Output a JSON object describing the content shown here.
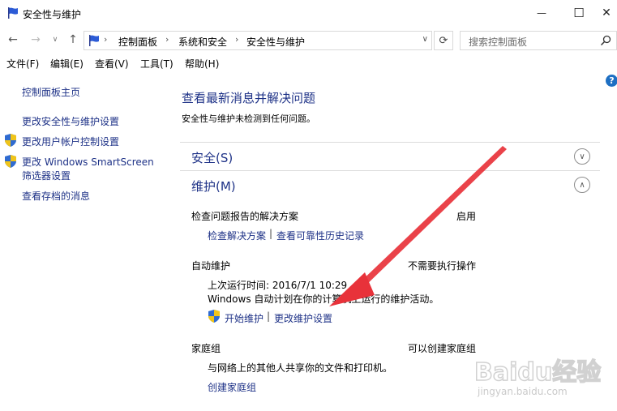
{
  "window": {
    "title": "安全性与维护",
    "minimize": "—",
    "maximize": "☐",
    "close": "✕"
  },
  "nav": {
    "back": "←",
    "forward": "→",
    "dropdown": "∨",
    "up": "↑",
    "breadcrumbs": [
      "控制面板",
      "系统和安全",
      "安全性与维护"
    ],
    "separator": "›",
    "refresh": "⟳",
    "search_placeholder": "搜索控制面板"
  },
  "menu": [
    "文件(F)",
    "编辑(E)",
    "查看(V)",
    "工具(T)",
    "帮助(H)"
  ],
  "help": "?",
  "sidebar": {
    "home": "控制面板主页",
    "items": [
      {
        "label": "更改安全性与维护设置",
        "shield": false
      },
      {
        "label": "更改用户帐户控制设置",
        "shield": true
      },
      {
        "label": "更改 Windows SmartScreen",
        "label2": "筛选器设置",
        "shield": true
      },
      {
        "label": "查看存档的消息",
        "shield": false
      }
    ]
  },
  "main": {
    "title": "查看最新消息并解决问题",
    "subtitle": "安全性与维护未检测到任何问题。",
    "sections": [
      {
        "label": "安全(S)",
        "chevron": "∨",
        "expanded": false
      },
      {
        "label": "维护(M)",
        "chevron": "∧",
        "expanded": true
      }
    ],
    "maintenance": {
      "problem_reports": {
        "name": "检查问题报告的解决方案",
        "status": "启用",
        "links": [
          "检查解决方案",
          "查看可靠性历史记录"
        ]
      },
      "auto_maintenance": {
        "name": "自动维护",
        "status": "不需要执行操作",
        "last_run": "上次运行时间: 2016/7/1 10:29",
        "description": "Windows 自动计划在你的计算机上运行的维护活动。",
        "links": [
          "开始维护",
          "更改维护设置"
        ]
      },
      "homegroup": {
        "name": "家庭组",
        "status": "可以创建家庭组",
        "description": "与网络上的其他人共享你的文件和打印机。",
        "link": "创建家庭组"
      }
    }
  },
  "watermark": {
    "text": "Baidu经验",
    "sub": "jingyan.baidu.com"
  },
  "colors": {
    "link": "#1e3287",
    "arrow": "#e8323a",
    "help": "#1e6fc3"
  }
}
